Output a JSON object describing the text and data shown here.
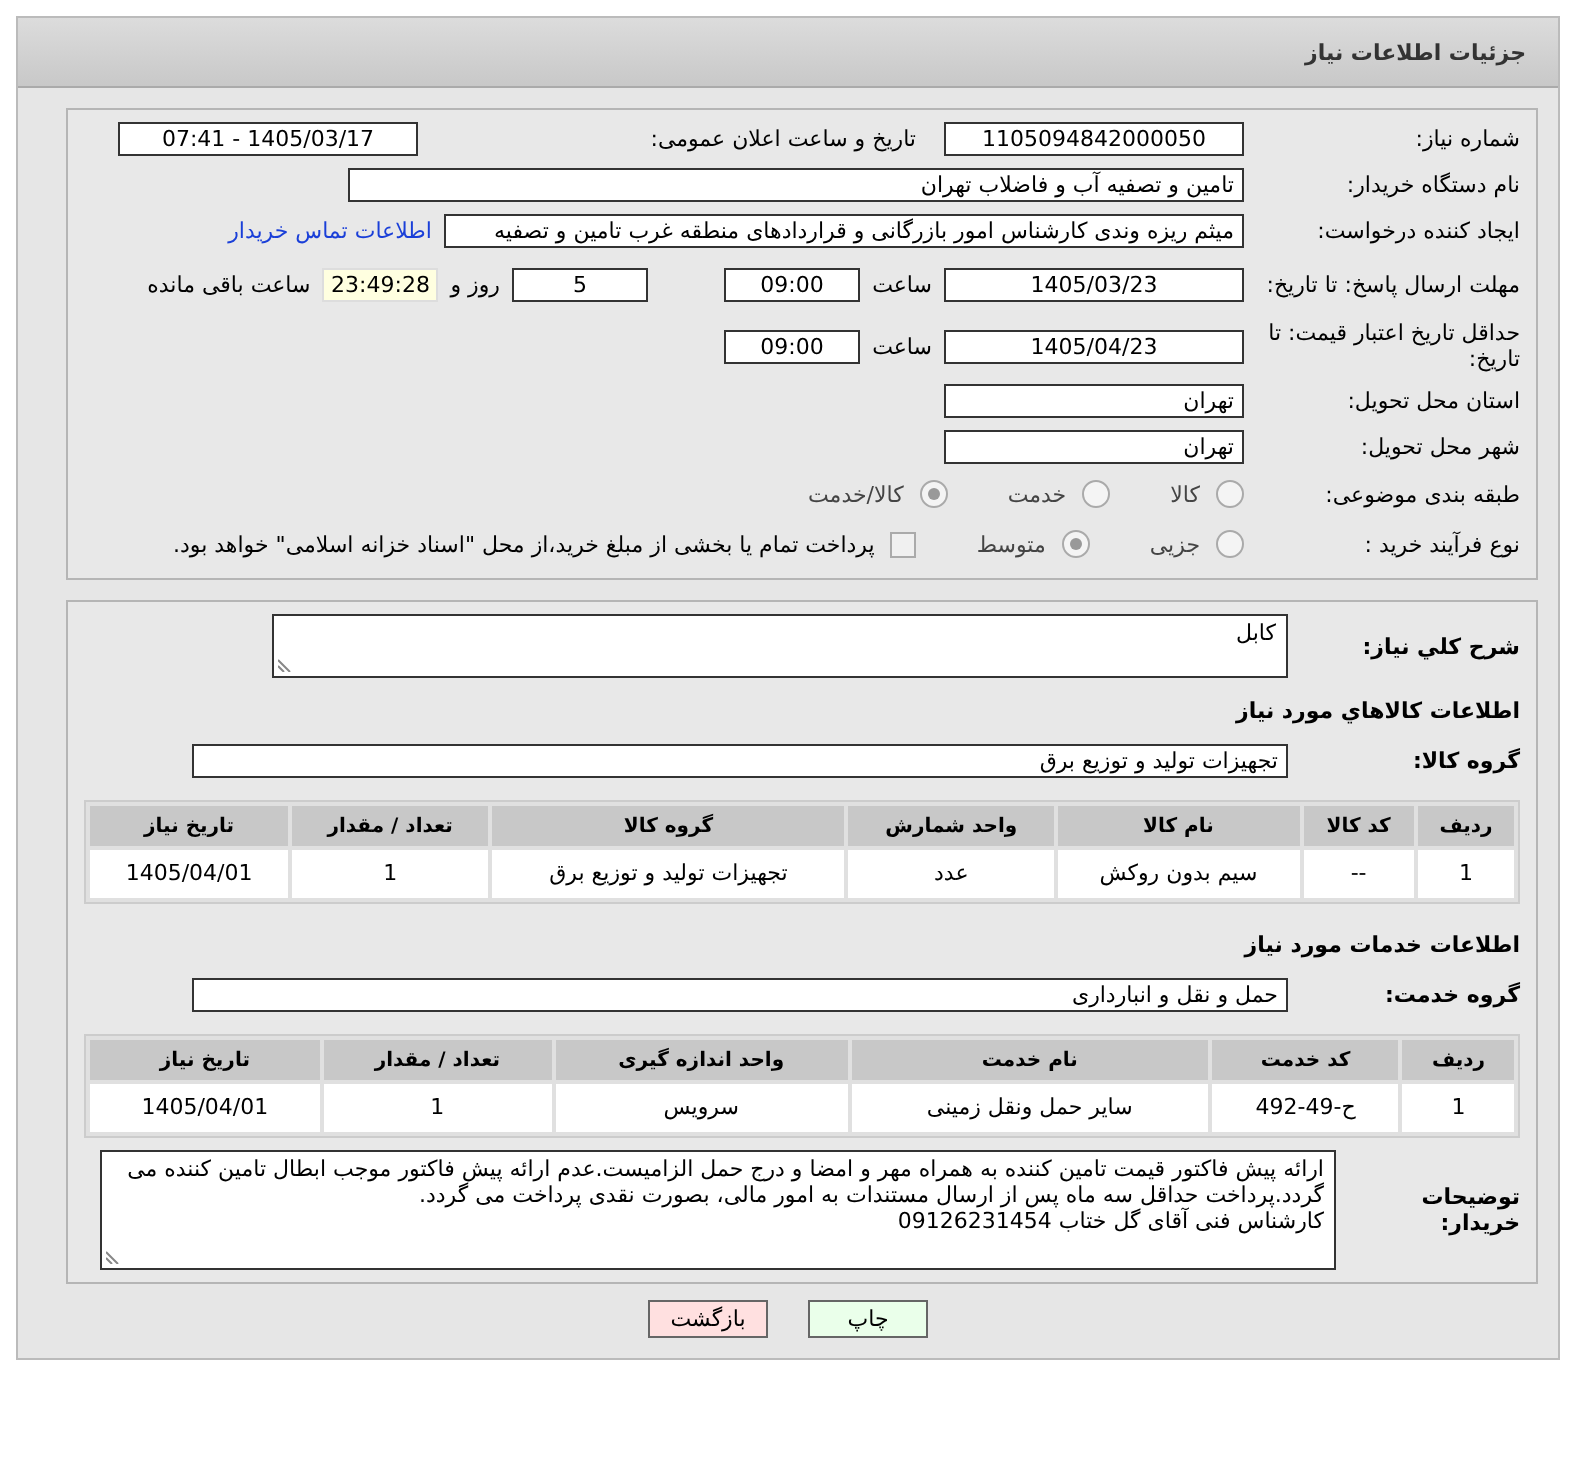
{
  "header": {
    "title": "جزئیات اطلاعات نیاز"
  },
  "info": {
    "need_number": {
      "label": "شماره نیاز:",
      "value": "1105094842000050"
    },
    "announce": {
      "label": "تاریخ و ساعت اعلان عمومی:",
      "value": "1405/03/17 - 07:41"
    },
    "buyer": {
      "label": "نام دستگاه خریدار:",
      "value": "تامین و تصفیه آب و فاضلاب تهران"
    },
    "creator": {
      "label": "ایجاد کننده درخواست:",
      "value": "میثم ریزه وندی کارشناس امور بازرگانی و قراردادهای منطقه غرب تامین و تصفیه",
      "link": "اطلاعات تماس خریدار"
    },
    "deadline": {
      "label": "مهلت ارسال پاسخ: تا تاریخ:",
      "date": "1405/03/23",
      "time_label": "ساعت",
      "time": "09:00",
      "days": "5",
      "days_label": "روز و",
      "remaining": "23:49:28",
      "remaining_label": "ساعت باقی مانده"
    },
    "validity": {
      "label": "حداقل تاریخ اعتبار قیمت: تا تاریخ:",
      "date": "1405/04/23",
      "time_label": "ساعت",
      "time": "09:00"
    },
    "province": {
      "label": "استان محل تحویل:",
      "value": "تهران"
    },
    "city": {
      "label": "شهر محل تحویل:",
      "value": "تهران"
    },
    "category": {
      "label": "طبقه بندی موضوعی:",
      "options": [
        {
          "label": "کالا",
          "selected": false
        },
        {
          "label": "خدمت",
          "selected": false
        },
        {
          "label": "کالا/خدمت",
          "selected": true
        }
      ]
    },
    "process": {
      "label": "نوع فرآیند خرید :",
      "options": [
        {
          "label": "جزیی",
          "selected": false
        },
        {
          "label": "متوسط",
          "selected": true
        }
      ],
      "payment": {
        "label": "پرداخت تمام یا بخشی از مبلغ خرید،از محل \"اسناد خزانه اسلامی\" خواهد بود.",
        "checked": false
      }
    }
  },
  "details": {
    "description": {
      "label": "شرح کلي نیاز:",
      "value": "کابل"
    },
    "goods": {
      "title": "اطلاعات کالاهاي مورد نیاز",
      "group_label": "گروه کالا:",
      "group": "تجهیزات تولید و توزیع برق",
      "columns": [
        "ردیف",
        "کد کالا",
        "نام کالا",
        "واحد شمارش",
        "گروه کالا",
        "تعداد / مقدار",
        "تاریخ نیاز"
      ],
      "rows": [
        [
          "1",
          "--",
          "سیم بدون روکش",
          "عدد",
          "تجهیزات تولید و توزیع برق",
          "1",
          "1405/04/01"
        ]
      ]
    },
    "services": {
      "title": "اطلاعات خدمات مورد نیاز",
      "group_label": "گروه خدمت:",
      "group": "حمل و نقل و انبارداری",
      "columns": [
        "ردیف",
        "کد خدمت",
        "نام خدمت",
        "واحد اندازه گیری",
        "تعداد / مقدار",
        "تاریخ نیاز"
      ],
      "rows": [
        [
          "1",
          "ح-49-492",
          "سایر حمل ونقل زمینی",
          "سرویس",
          "1",
          "1405/04/01"
        ]
      ]
    },
    "notes": {
      "label": "توضیحات خریدار:",
      "value": "ارائه پیش فاکتور قیمت تامین کننده به همراه مهر و امضا و درج حمل الزامیست.عدم ارائه پیش فاکتور موجب ابطال تامین کننده می گردد.پرداخت حداقل سه ماه پس از ارسال مستندات به امور مالی، بصورت نقدی پرداخت می گردد.\nکارشناس فنی آقای گل ختاب 09126231454"
    }
  },
  "buttons": {
    "print": "چاپ",
    "back": "بازگشت"
  }
}
